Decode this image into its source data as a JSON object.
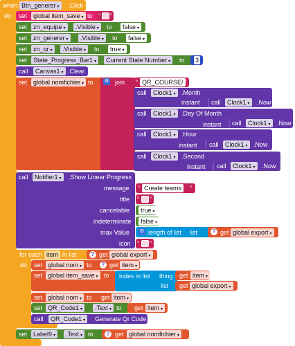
{
  "event": {
    "when": "when",
    "component": "Btn_generer",
    "event": ".Click",
    "do": "do"
  },
  "kw": {
    "set": "set",
    "to": "to",
    "call": "call",
    "get": "get",
    "instant": "instant",
    "join": "join",
    "for_each": "for each",
    "in_list": "in list",
    "do": "do",
    "dot_visible": ".Visible",
    "dot_text": ".Text",
    "dot_clear": ".Clear",
    "dot_now": ".Now",
    "dot_month": ".Month",
    "dot_day": ".Day Of Month",
    "dot_hour": ".Hour",
    "dot_second": ".Second",
    "show_progress": ".Show Linear Progress",
    "message": "message",
    "title": "title",
    "cancelable": "cancelable",
    "indeterminate": "indeterminate",
    "max_value": "max Value",
    "icon": "icon",
    "length_of_list": "length of list",
    "list": "list",
    "index_in_list": "index in list",
    "thing": "thing",
    "generate_qr": "Generate Qr Code",
    "current_state": ".",
    "current_state_prop": "Current State Number"
  },
  "vars": {
    "item_save": "global item_save",
    "nomfichier": "global nomfichier",
    "export": "global export",
    "nom": "global nom",
    "item": "item"
  },
  "components": {
    "zn_equipe": "zn_equipe",
    "zn_generer": "zn_generer",
    "zn_qr": "zn_qr",
    "progress": "State_Progress_Bar1",
    "canvas": "Canvas1",
    "clock": "Clock1",
    "notifier": "Notifier1",
    "qr": "QR_Code1",
    "label": "Label9"
  },
  "values": {
    "false": "false",
    "true": "true",
    "three": "3",
    "qr_prefix": "QR_COURSE/",
    "create_teams": "Create teams"
  },
  "colors": {
    "event": "#f5a623",
    "variable": "#e2236c",
    "component": "#4e8a2e",
    "text": "#c5215a",
    "method": "#6236a8",
    "control": "#f5a623",
    "list": "#0096d9",
    "math": "#2b4bc4",
    "logic": "#4e8a2e",
    "local": "#e2562e"
  }
}
